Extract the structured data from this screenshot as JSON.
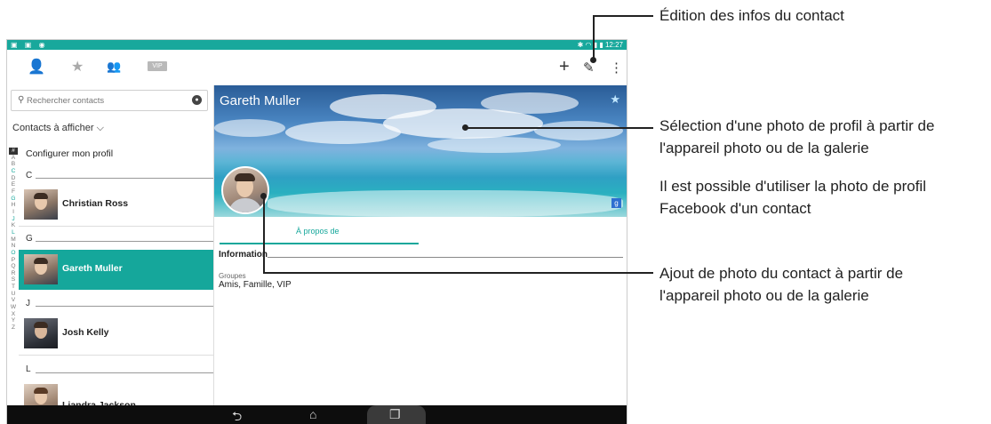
{
  "status_bar": {
    "left_icons": "▣ ▣ ◉",
    "right_icons": "✱ ◠ ▮ ▮",
    "time": "12:27"
  },
  "action_bar": {
    "tabs": [
      {
        "icon": "person-icon",
        "glyph": "👤"
      },
      {
        "icon": "star-icon",
        "glyph": "★"
      },
      {
        "icon": "group-icon",
        "glyph": "👥"
      },
      {
        "icon": "vip-icon",
        "glyph": "VIP"
      }
    ],
    "add_glyph": "+",
    "edit_glyph": "✎",
    "overflow_glyph": "⋮"
  },
  "search": {
    "placeholder": "Rechercher contacts",
    "mag_glyph": "⚲",
    "mic_glyph": "●"
  },
  "filter_label": "Contacts à afficher ⌵",
  "alphabet": [
    "#",
    "A",
    "B",
    "C",
    "D",
    "E",
    "F",
    "G",
    "H",
    "I",
    "J",
    "K",
    "L",
    "M",
    "N",
    "O",
    "P",
    "Q",
    "R",
    "S",
    "T",
    "U",
    "V",
    "W",
    "X",
    "Y",
    "Z"
  ],
  "alphabet_active": [
    "C",
    "G",
    "J",
    "L",
    "O"
  ],
  "profile_row": "Configurer mon profil",
  "contacts": {
    "sections": [
      "C",
      "G",
      "J",
      "L"
    ],
    "names": [
      "Christian Ross",
      "Gareth Muller",
      "Josh Kelly",
      "Liandra Jackson"
    ]
  },
  "detail": {
    "name": "Gareth Muller",
    "star": "★",
    "gplus": "g",
    "tab_about": "À propos de",
    "info_heading": "Information",
    "groups_label": "Groupes",
    "groups_value": "Amis, Famille, VIP"
  },
  "nav": {
    "back": "⮌",
    "home": "⌂",
    "recent": "❐"
  },
  "callouts": {
    "edit": "Édition des infos du contact",
    "cover_1": "Sélection d'une photo de profil à partir de",
    "cover_2": "l'appareil photo ou de la galerie",
    "fb_1": "Il est possible d'utiliser la photo de profil",
    "fb_2": "Facebook d'un contact",
    "photo_1": "Ajout de photo du contact à partir de",
    "photo_2": "l'appareil photo ou de la galerie"
  },
  "colors": {
    "accent": "#15a79b",
    "statusbar": "#18a89c"
  }
}
